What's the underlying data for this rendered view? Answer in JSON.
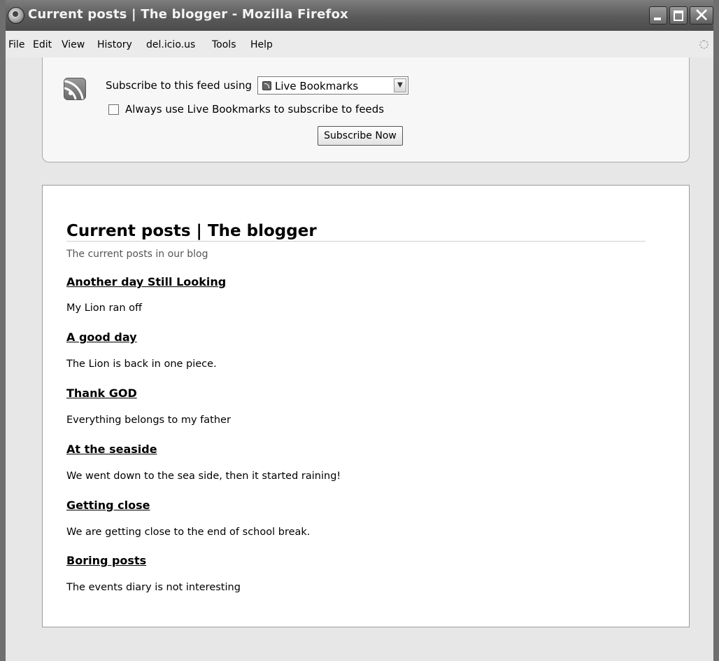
{
  "window": {
    "title": "Current posts | The blogger - Mozilla Firefox",
    "close_glyph": "✕"
  },
  "menubar": {
    "items": [
      "File",
      "Edit",
      "View",
      "History",
      "del.icio.us",
      "Tools",
      "Help"
    ]
  },
  "subscribe": {
    "label": "Subscribe to this feed using",
    "reader": "Live Bookmarks",
    "always_label": "Always use Live Bookmarks to subscribe to feeds",
    "always_checked": false,
    "button_label": "Subscribe Now"
  },
  "feed": {
    "title": "Current posts | The blogger",
    "subtitle": "The current posts in our blog",
    "entries": [
      {
        "title": "Another day Still Looking",
        "body": "My Lion ran off"
      },
      {
        "title": "A good day",
        "body": "The Lion is back in one piece."
      },
      {
        "title": "Thank GOD",
        "body": "Everything belongs to my father"
      },
      {
        "title": "At the seaside",
        "body": "We went down to the sea side, then it started raining!"
      },
      {
        "title": "Getting close",
        "body": "We are getting close to the end of school break."
      },
      {
        "title": "Boring posts",
        "body": "The events diary is not interesting"
      }
    ]
  },
  "colors": {
    "titlebar": "#5a5a5a",
    "chrome_background": "#e7e7e7",
    "content_background": "#ffffff"
  },
  "icons": {
    "app": "firefox-icon",
    "feed": "rss-icon",
    "loading": "throbber-icon"
  }
}
